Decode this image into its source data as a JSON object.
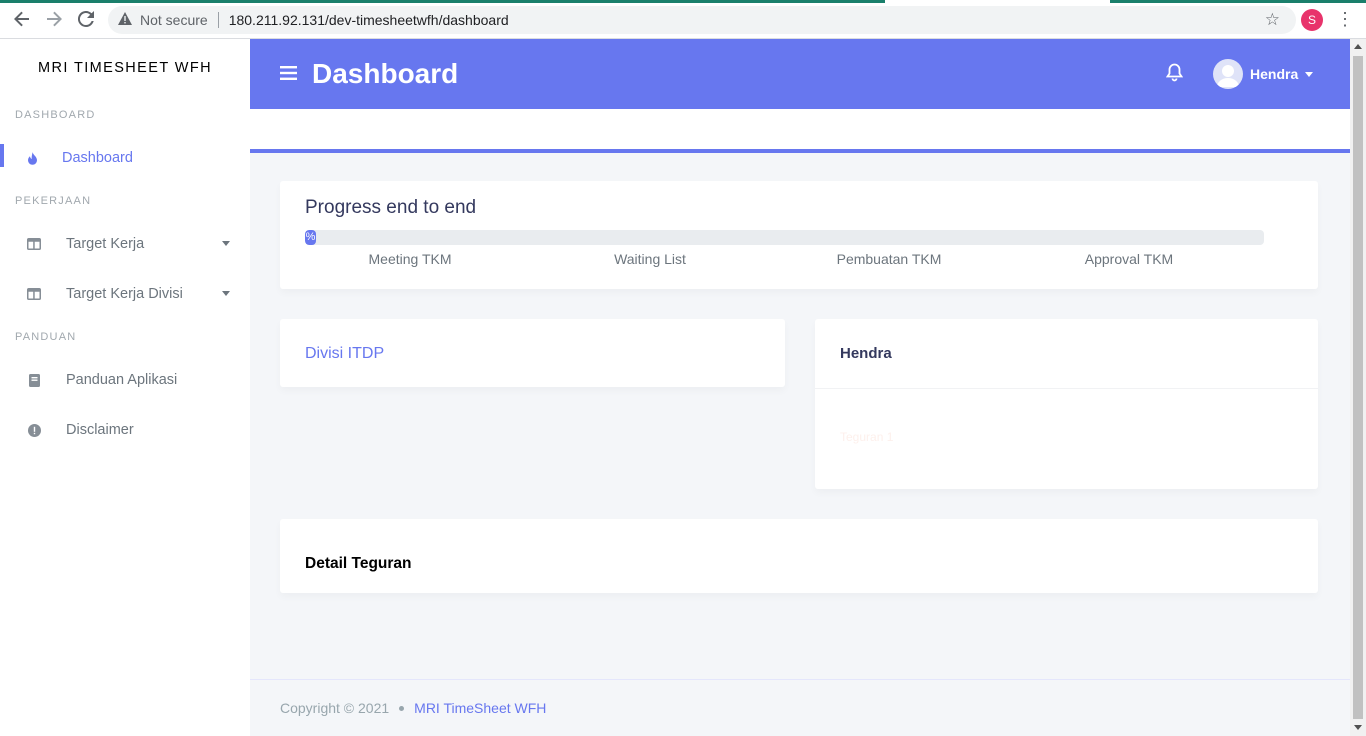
{
  "browser": {
    "security_label": "Not secure",
    "url": "180.211.92.131/dev-timesheetwfh/dashboard",
    "profile_initial": "S",
    "profile_color": "#e8336b"
  },
  "sidebar": {
    "brand": "MRI TIMESHEET WFH",
    "sections": [
      {
        "header": "DASHBOARD",
        "items": [
          {
            "label": "Dashboard",
            "icon": "fire-icon",
            "active": true
          }
        ]
      },
      {
        "header": "PEKERJAAN",
        "items": [
          {
            "label": "Target Kerja",
            "icon": "columns-icon",
            "dropdown": true
          },
          {
            "label": "Target Kerja Divisi",
            "icon": "columns-icon",
            "dropdown": true
          }
        ]
      },
      {
        "header": "PANDUAN",
        "items": [
          {
            "label": "Panduan Aplikasi",
            "icon": "book-icon"
          },
          {
            "label": "Disclaimer",
            "icon": "exclamation-circle-icon"
          }
        ]
      }
    ]
  },
  "topbar": {
    "title": "Dashboard",
    "user_name": "Hendra",
    "icons": [
      "hamburger-icon",
      "bell-icon",
      "avatar"
    ]
  },
  "progress_card": {
    "title": "Progress end to end",
    "progress_label": "%",
    "progress_value_percent": 0,
    "steps": [
      "Meeting TKM",
      "Waiting List",
      "Pembuatan TKM",
      "Approval TKM"
    ]
  },
  "divisi_card": {
    "title": "Divisi ITDP"
  },
  "user_card": {
    "title": "Hendra",
    "teguran": "Teguran 1"
  },
  "detail_card": {
    "title": "Detail Teguran"
  },
  "footer": {
    "copyright": "Copyright © 2021",
    "app_link": "MRI TimeSheet WFH"
  },
  "colors": {
    "primary": "#6777ef",
    "sidebar_bg": "#ffffff",
    "page_bg": "#f4f6f9"
  }
}
